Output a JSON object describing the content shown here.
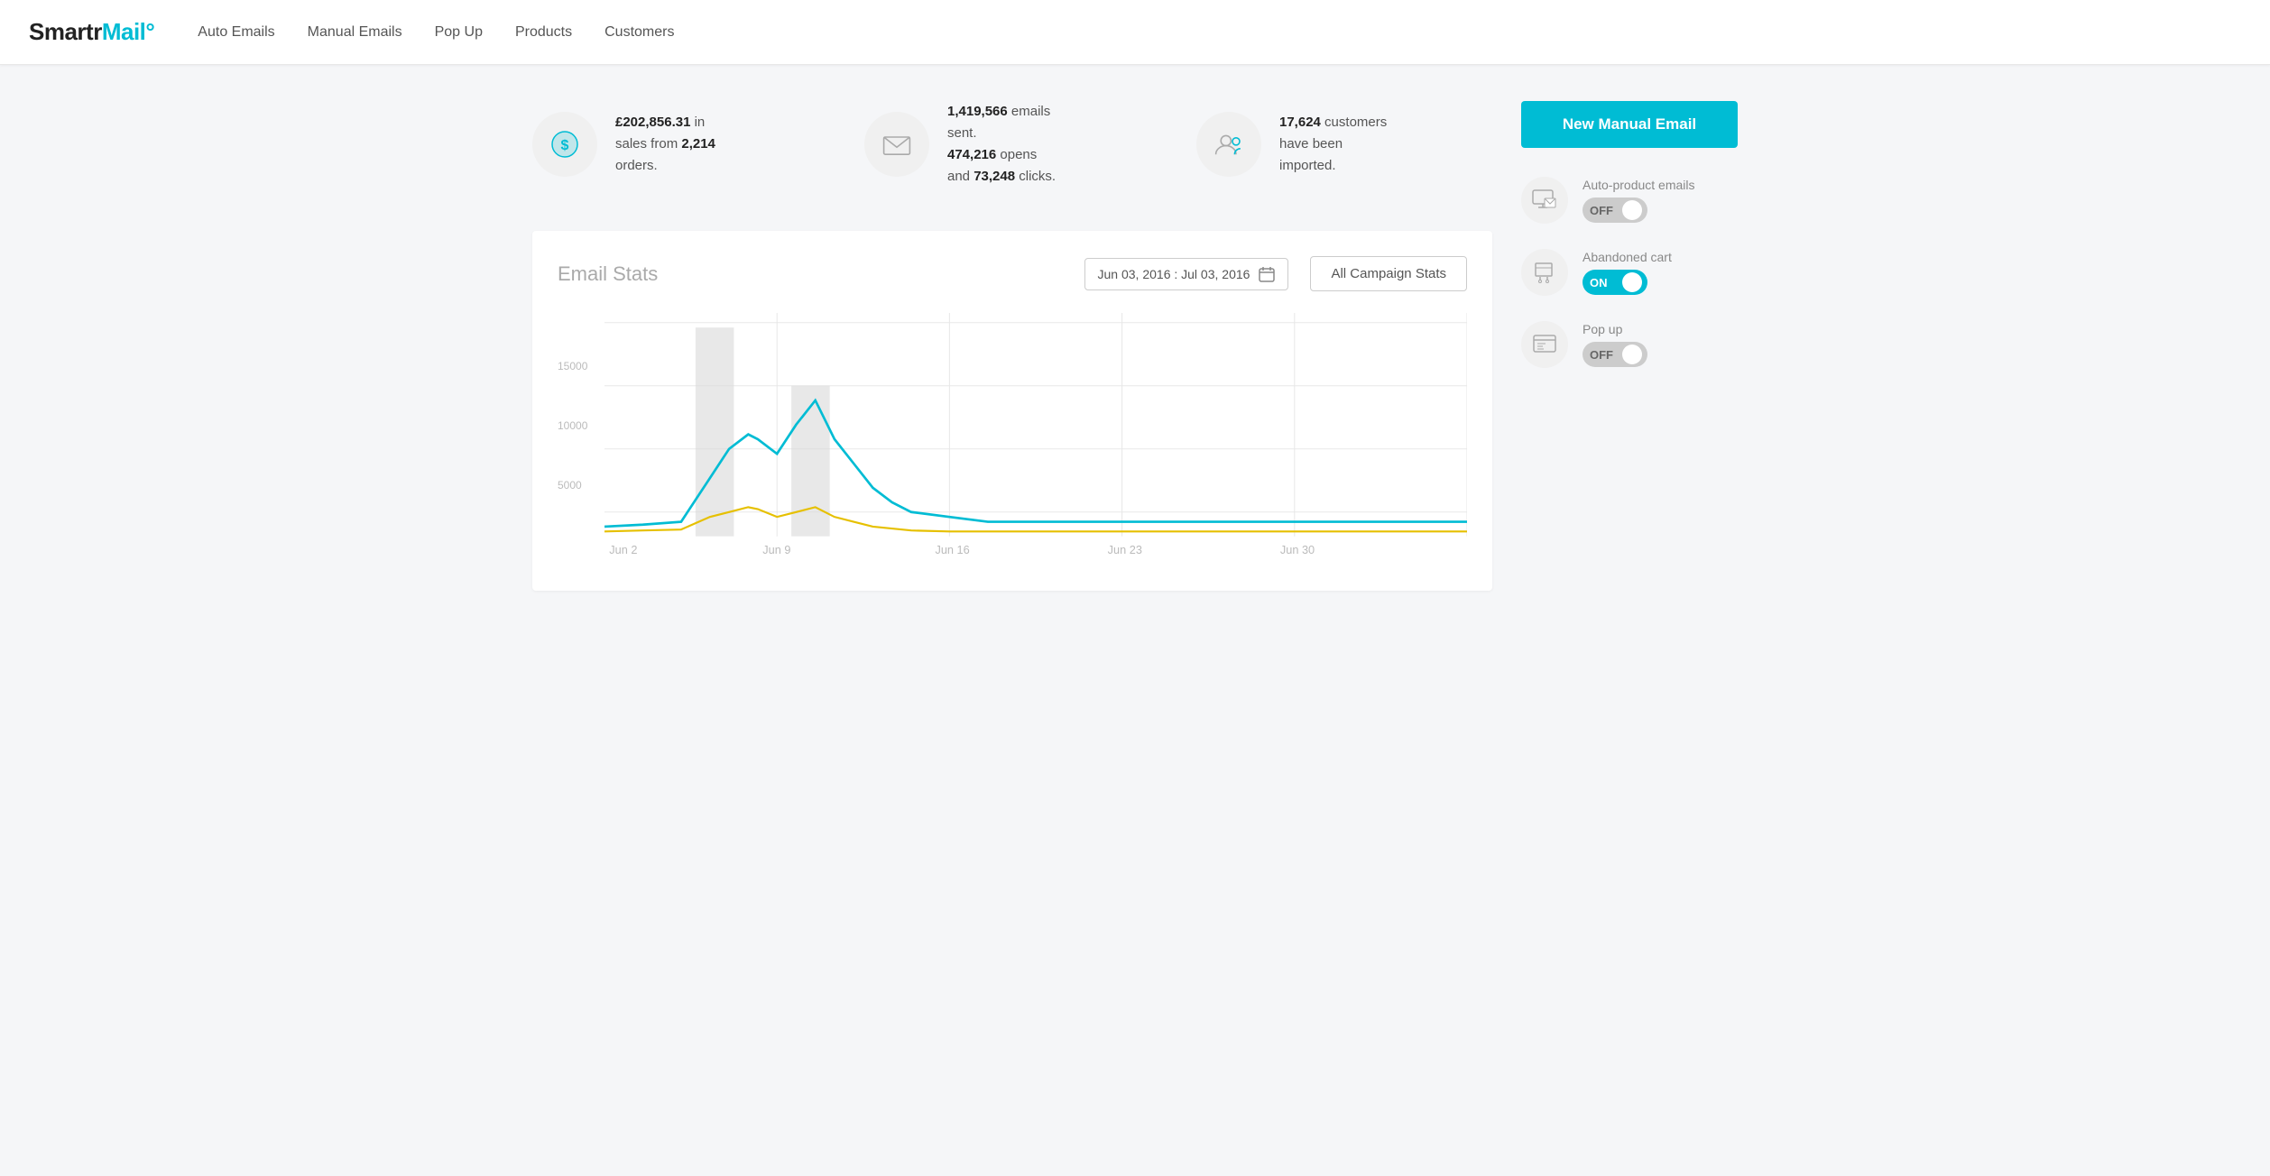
{
  "header": {
    "logo_text": "SmartrMail",
    "logo_symbol": "°",
    "nav": [
      {
        "id": "auto-emails",
        "label": "Auto Emails"
      },
      {
        "id": "manual-emails",
        "label": "Manual Emails"
      },
      {
        "id": "pop-up",
        "label": "Pop Up"
      },
      {
        "id": "products",
        "label": "Products"
      },
      {
        "id": "customers",
        "label": "Customers"
      }
    ]
  },
  "stats": [
    {
      "id": "sales",
      "icon": "dollar",
      "text_parts": [
        "£202,856.31",
        " in\nsales from ",
        "2,214",
        "\norders."
      ]
    },
    {
      "id": "emails",
      "icon": "email",
      "text_parts": [
        "1,419,566",
        " emails\nsent.\n",
        "474,216",
        " opens\nand ",
        "73,248",
        " clicks."
      ]
    },
    {
      "id": "customers",
      "icon": "customers",
      "text_parts": [
        "17,624",
        " customers\nhave been\nimported."
      ]
    }
  ],
  "chart": {
    "title": "Email Stats",
    "date_range": "Jun 03, 2016 : Jul 03, 2016",
    "all_campaign_label": "All Campaign Stats",
    "y_labels": [
      "15000",
      "10000",
      "5000",
      ""
    ],
    "x_labels": [
      "Jun 2",
      "Jun 9",
      "Jun 16",
      "Jun 23",
      "Jun 30"
    ]
  },
  "sidebar": {
    "new_manual_email_label": "New Manual Email",
    "toggles": [
      {
        "id": "auto-product",
        "icon": "monitor-email",
        "label": "Auto-product emails",
        "state": "OFF",
        "is_on": false
      },
      {
        "id": "abandoned-cart",
        "icon": "cart-email",
        "label": "Abandoned cart",
        "state": "ON",
        "is_on": true
      },
      {
        "id": "pop-up",
        "icon": "popup",
        "label": "Pop up",
        "state": "OFF",
        "is_on": false
      }
    ]
  }
}
